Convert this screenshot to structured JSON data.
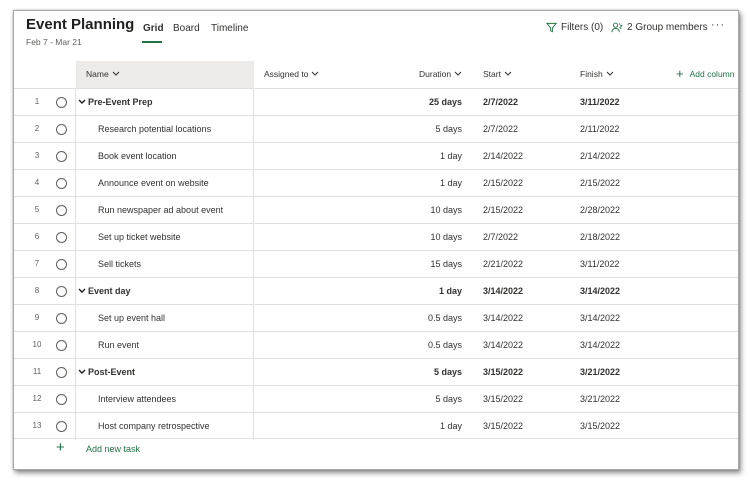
{
  "header": {
    "title": "Event Planning",
    "date_range": "Feb 7 - Mar 21",
    "tabs": [
      "Grid",
      "Board",
      "Timeline"
    ],
    "active_tab": "Grid",
    "filters_label": "Filters (0)",
    "group_members_label": "2 Group members",
    "more_label": "···",
    "accent_color": "#217346"
  },
  "columns": {
    "name": "Name",
    "assigned": "Assigned to",
    "duration": "Duration",
    "start": "Start",
    "finish": "Finish",
    "add_column": "Add column"
  },
  "tasks": [
    {
      "num": "1",
      "name": "Pre-Event Prep",
      "summary": true,
      "duration": "25 days",
      "start": "2/7/2022",
      "finish": "3/11/2022"
    },
    {
      "num": "2",
      "name": "Research potential locations",
      "summary": false,
      "duration": "5 days",
      "start": "2/7/2022",
      "finish": "2/11/2022"
    },
    {
      "num": "3",
      "name": "Book event location",
      "summary": false,
      "duration": "1 day",
      "start": "2/14/2022",
      "finish": "2/14/2022"
    },
    {
      "num": "4",
      "name": "Announce event on website",
      "summary": false,
      "duration": "1 day",
      "start": "2/15/2022",
      "finish": "2/15/2022"
    },
    {
      "num": "5",
      "name": "Run newspaper ad about event",
      "summary": false,
      "duration": "10 days",
      "start": "2/15/2022",
      "finish": "2/28/2022"
    },
    {
      "num": "6",
      "name": "Set up ticket website",
      "summary": false,
      "duration": "10 days",
      "start": "2/7/2022",
      "finish": "2/18/2022"
    },
    {
      "num": "7",
      "name": "Sell tickets",
      "summary": false,
      "duration": "15 days",
      "start": "2/21/2022",
      "finish": "3/11/2022"
    },
    {
      "num": "8",
      "name": "Event day",
      "summary": true,
      "duration": "1 day",
      "start": "3/14/2022",
      "finish": "3/14/2022"
    },
    {
      "num": "9",
      "name": "Set up event hall",
      "summary": false,
      "duration": "0.5 days",
      "start": "3/14/2022",
      "finish": "3/14/2022"
    },
    {
      "num": "10",
      "name": "Run event",
      "summary": false,
      "duration": "0.5 days",
      "start": "3/14/2022",
      "finish": "3/14/2022"
    },
    {
      "num": "11",
      "name": "Post-Event",
      "summary": true,
      "duration": "5 days",
      "start": "3/15/2022",
      "finish": "3/21/2022"
    },
    {
      "num": "12",
      "name": "Interview attendees",
      "summary": false,
      "duration": "5 days",
      "start": "3/15/2022",
      "finish": "3/21/2022"
    },
    {
      "num": "13",
      "name": "Host company retrospective",
      "summary": false,
      "duration": "1 day",
      "start": "3/15/2022",
      "finish": "3/15/2022"
    }
  ],
  "add_task_label": "Add new task"
}
